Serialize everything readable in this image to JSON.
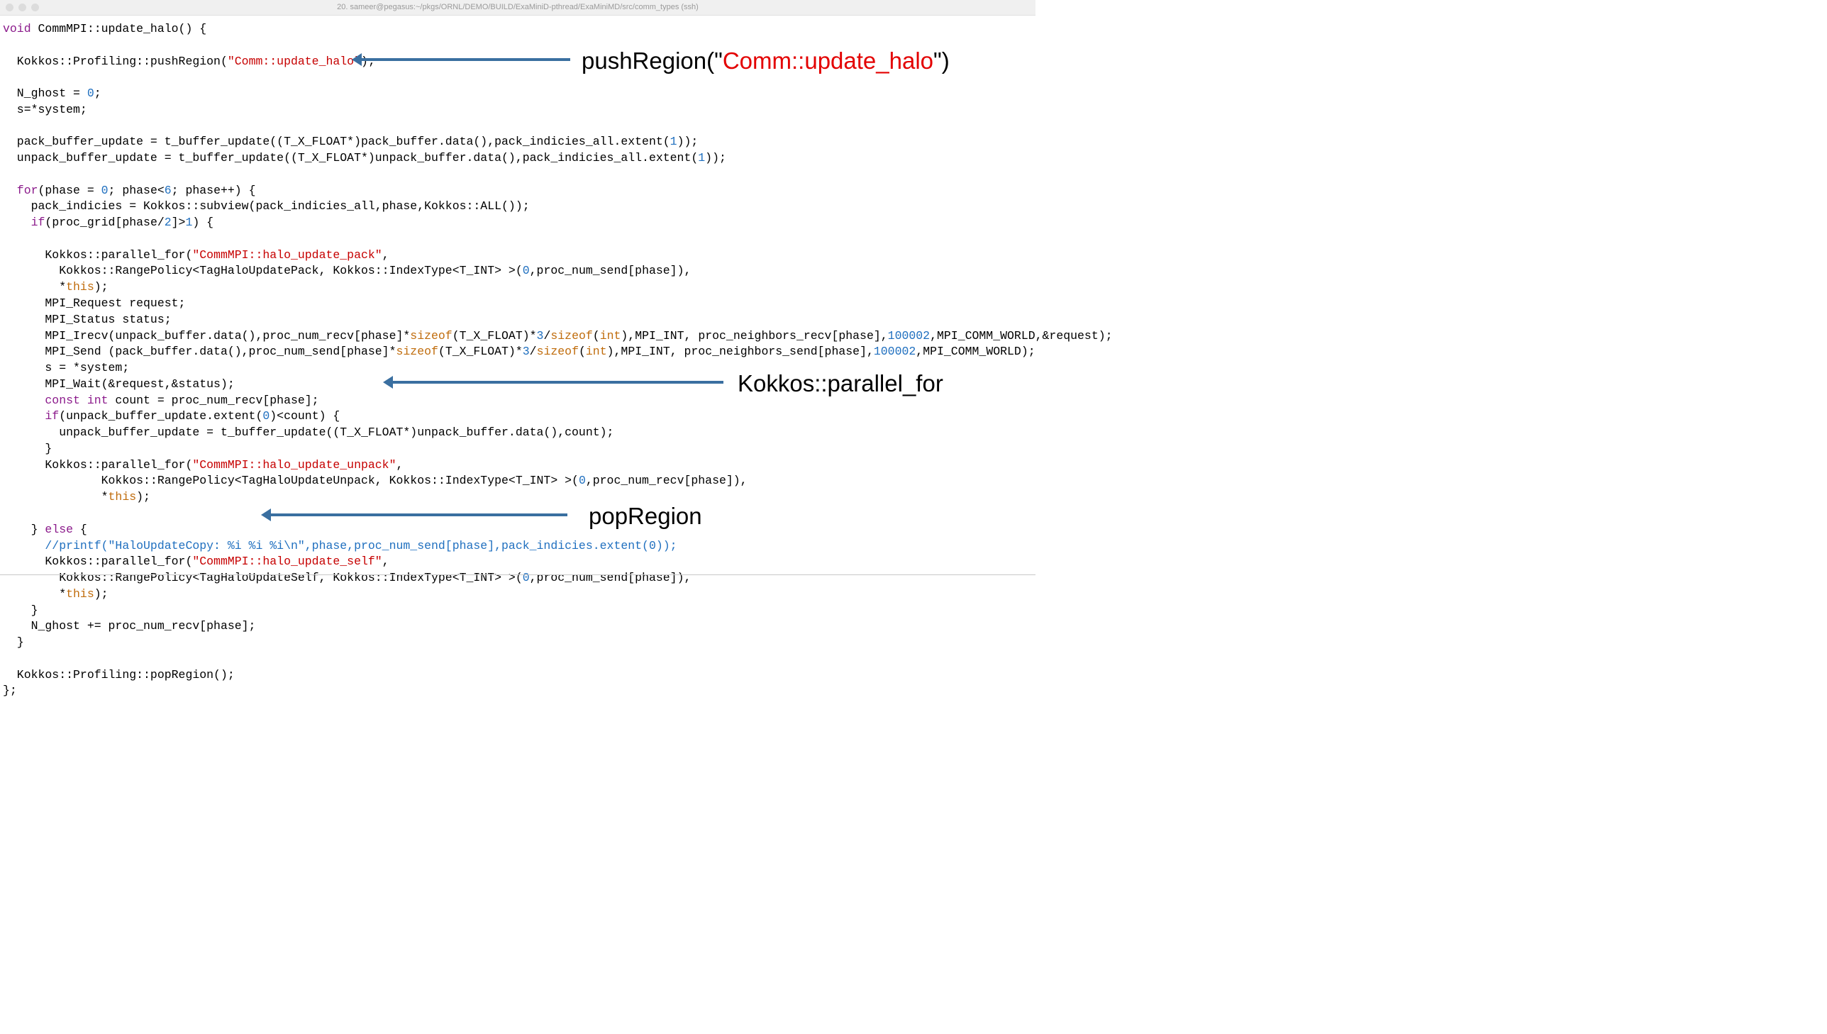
{
  "window": {
    "title": "20. sameer@pegasus:~/pkgs/ORNL/DEMO/BUILD/ExaMiniD-pthread/ExaMiniMD/src/comm_types (ssh)"
  },
  "annotations": {
    "push_prefix": "pushRegion(\"",
    "push_mid": "Comm::update_halo",
    "push_suffix": "\")",
    "parallel_for": "Kokkos::parallel_for",
    "pop": "popRegion"
  },
  "code": {
    "l01a": "void",
    "l01b": " CommMPI::update_halo() {",
    "l02": "",
    "l03a": "  Kokkos::Profiling::pushRegion(",
    "l03b": "\"Comm::update_halo\"",
    "l03c": ");",
    "l04": "",
    "l05a": "  N_ghost = ",
    "l05b": "0",
    "l05c": ";",
    "l06": "  s=*system;",
    "l07": "",
    "l08a": "  pack_buffer_update = t_buffer_update((T_X_FLOAT*)pack_buffer.data(),pack_indicies_all.extent(",
    "l08b": "1",
    "l08c": "));",
    "l09a": "  unpack_buffer_update = t_buffer_update((T_X_FLOAT*)unpack_buffer.data(),pack_indicies_all.extent(",
    "l09b": "1",
    "l09c": "));",
    "l10": "",
    "l11a": "  for",
    "l11b": "(phase = ",
    "l11c": "0",
    "l11d": "; phase<",
    "l11e": "6",
    "l11f": "; phase++) {",
    "l12": "    pack_indicies = Kokkos::subview(pack_indicies_all,phase,Kokkos::ALL());",
    "l13a": "    if",
    "l13b": "(proc_grid[phase/",
    "l13c": "2",
    "l13d": "]>",
    "l13e": "1",
    "l13f": ") {",
    "l14": "",
    "l15a": "      Kokkos::parallel_for(",
    "l15b": "\"CommMPI::halo_update_pack\"",
    "l15c": ",",
    "l16a": "        Kokkos::RangePolicy<TagHaloUpdatePack, Kokkos::IndexType<T_INT> >(",
    "l16b": "0",
    "l16c": ",proc_num_send[phase]),",
    "l17a": "        *",
    "l17b": "this",
    "l17c": ");",
    "l18": "      MPI_Request request;",
    "l19": "      MPI_Status status;",
    "l20a": "      MPI_Irecv(unpack_buffer.data(),proc_num_recv[phase]*",
    "l20b": "sizeof",
    "l20c": "(T_X_FLOAT)*",
    "l20d": "3",
    "l20e": "/",
    "l20f": "sizeof",
    "l20g": "(",
    "l20h": "int",
    "l20i": "),MPI_INT, proc_neighbors_recv[phase],",
    "l20j": "100002",
    "l20k": ",MPI_COMM_WORLD,&request);",
    "l21a": "      MPI_Send (pack_buffer.data(),proc_num_send[phase]*",
    "l21b": "sizeof",
    "l21c": "(T_X_FLOAT)*",
    "l21d": "3",
    "l21e": "/",
    "l21f": "sizeof",
    "l21g": "(",
    "l21h": "int",
    "l21i": "),MPI_INT, proc_neighbors_send[phase],",
    "l21j": "100002",
    "l21k": ",MPI_COMM_WORLD);",
    "l22": "      s = *system;",
    "l23": "      MPI_Wait(&request,&status);",
    "l24a": "      const int",
    "l24b": " count = proc_num_recv[phase];",
    "l25a": "      if",
    "l25b": "(unpack_buffer_update.extent(",
    "l25c": "0",
    "l25d": ")<count) {",
    "l26": "        unpack_buffer_update = t_buffer_update((T_X_FLOAT*)unpack_buffer.data(),count);",
    "l27": "      }",
    "l28a": "      Kokkos::parallel_for(",
    "l28b": "\"CommMPI::halo_update_unpack\"",
    "l28c": ",",
    "l29a": "              Kokkos::RangePolicy<TagHaloUpdateUnpack, Kokkos::IndexType<T_INT> >(",
    "l29b": "0",
    "l29c": ",proc_num_recv[phase]),",
    "l30a": "              *",
    "l30b": "this",
    "l30c": ");",
    "l31": "",
    "l32a": "    } ",
    "l32b": "else",
    "l32c": " {",
    "l33": "      //printf(\"HaloUpdateCopy: %i %i %i\\n\",phase,proc_num_send[phase],pack_indicies.extent(0));",
    "l34a": "      Kokkos::parallel_for(",
    "l34b": "\"CommMPI::halo_update_self\"",
    "l34c": ",",
    "l35a": "        Kokkos::RangePolicy<TagHaloUpdateSelf, Kokkos::IndexType<T_INT> >(",
    "l35b": "0",
    "l35c": ",proc_num_send[phase]),",
    "l36a": "        *",
    "l36b": "this",
    "l36c": ");",
    "l37": "    }",
    "l38": "    N_ghost += proc_num_recv[phase];",
    "l39": "  }",
    "l40": "",
    "l41": "  Kokkos::Profiling::popRegion();",
    "l42": "};"
  }
}
